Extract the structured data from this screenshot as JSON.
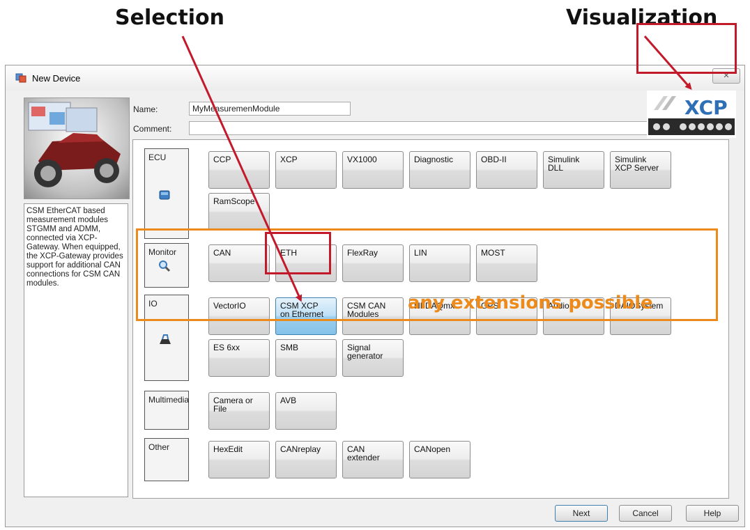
{
  "captions": {
    "selection": "Selection",
    "visualization": "Visualization"
  },
  "window": {
    "title": "New Device",
    "close": "✕"
  },
  "form": {
    "name_label": "Name:",
    "name_value": "MyMeasuremenModule",
    "comment_label": "Comment:",
    "comment_value": ""
  },
  "description": "CSM EtherCAT based measurement modules STGMM and ADMM, connected via XCP-Gateway. When equipped, the XCP-Gateway provides support for additional CAN connections for CSM CAN modules.",
  "categories": {
    "ecu": {
      "label": "ECU",
      "buttons": [
        "CCP",
        "XCP",
        "VX1000",
        "Diagnostic",
        "OBD-II",
        "Simulink\nDLL",
        "Simulink\nXCP Server",
        "RamScope"
      ]
    },
    "monitor": {
      "label": "Monitor",
      "buttons": [
        "CAN",
        "ETH",
        "FlexRay",
        "LIN",
        "MOST"
      ]
    },
    "io": {
      "label": "IO",
      "buttons": [
        "VectorIO",
        "CSM XCP\non Ethernet",
        "CSM CAN\nModules",
        "NI-DAQmx",
        "GPS",
        "Audio",
        "DAIOSystem",
        "ES 6xx",
        "SMB",
        "Signal\ngenerator"
      ],
      "selected": "CSM XCP\non Ethernet"
    },
    "multimedia": {
      "label": "Multimedia",
      "buttons": [
        "Camera or\nFile",
        "AVB"
      ]
    },
    "other": {
      "label": "Other",
      "buttons": [
        "HexEdit",
        "CANreplay",
        "CAN\nextender",
        "CANopen"
      ]
    }
  },
  "annotation": {
    "extensions": "any extensions possible"
  },
  "logo": {
    "text": "XCP"
  },
  "footer": {
    "next": "Next",
    "cancel": "Cancel",
    "help": "Help"
  },
  "colors": {
    "selection_box": "#c2192b",
    "extension_box": "#ec8a1c",
    "selected_button": "#9ecfee"
  }
}
